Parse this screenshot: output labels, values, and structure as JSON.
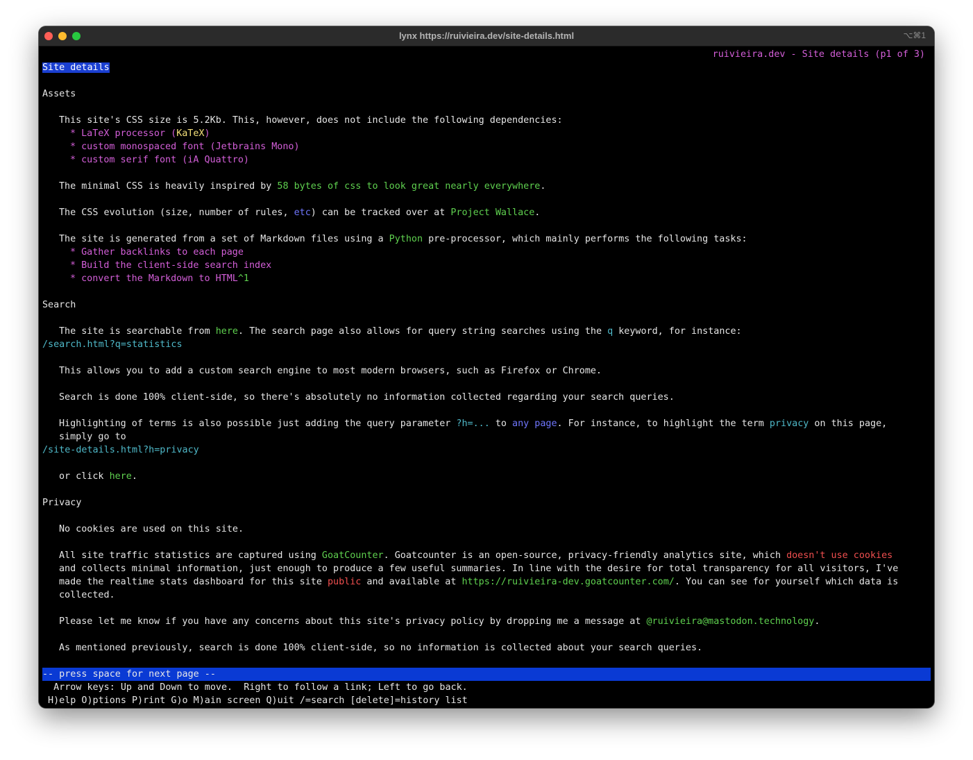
{
  "window": {
    "title": "lynx https://ruivieira.dev/site-details.html",
    "shortcut": "⌥⌘1"
  },
  "page_status": "ruivieira.dev - Site details (p1 of 3)",
  "page_title": "Site details",
  "assets": {
    "heading": "Assets",
    "css_size_text": "This site's CSS size is 5.2Kb. This, however, does not include the following dependencies:",
    "deps": [
      {
        "bullet": "* ",
        "text": "LaTeX processor (",
        "link": "KaTeX",
        "after": ")"
      },
      {
        "bullet": "* ",
        "text": "custom monospaced font (Jetbrains Mono)"
      },
      {
        "bullet": "* ",
        "text": "custom serif font (iA Quattro)"
      }
    ],
    "minimal_pre": "The minimal CSS is heavily inspired by ",
    "minimal_link": "58 bytes of css to look great nearly everywhere",
    "minimal_post": ".",
    "evo_pre": "The CSS evolution (size, number of rules, ",
    "evo_link": "etc",
    "evo_mid": ") can be tracked over at ",
    "evo_link2": "Project Wallace",
    "evo_post": ".",
    "gen_pre": "The site is generated from a set of Markdown files using a ",
    "gen_link": "Python",
    "gen_post": " pre-processor, which mainly performs the following tasks:",
    "tasks": [
      "* Gather backlinks to each page",
      "* Build the client-side search index",
      "* convert the Markdown to HTML"
    ],
    "footnote": "^1"
  },
  "search": {
    "heading": "Search",
    "p1_pre": "The site is searchable from ",
    "p1_link": "here",
    "p1_mid": ". The search page also allows for query string searches using the ",
    "p1_kw": "q",
    "p1_post": " keyword, for instance:",
    "example_url": "/search.html?q=statistics",
    "p2": "This allows you to add a custom search engine to most modern browsers, such as Firefox or Chrome.",
    "p3": "Search is done 100% client-side, so there's absolutely no information collected regarding your search queries.",
    "p4_pre": "Highlighting of terms is also possible just adding the query parameter ",
    "p4_param": "?h=...",
    "p4_mid": " to ",
    "p4_link": "any page",
    "p4_mid2": ". For instance, to highlight the term ",
    "p4_term": "privacy",
    "p4_post": " on this page,",
    "p4_line2": "simply go to",
    "highlight_url": "/site-details.html?h=privacy",
    "p5_pre": "or click ",
    "p5_link": "here",
    "p5_post": "."
  },
  "privacy": {
    "heading": "Privacy",
    "p1": "No cookies are used on this site.",
    "p2_l1_pre": "All site traffic statistics are captured using ",
    "p2_l1_link": "GoatCounter",
    "p2_l1_mid": ". Goatcounter is an open-source, privacy-friendly analytics site, which ",
    "p2_l1_red": "doesn't use cookies",
    "p2_l2": "and collects minimal information, just enough to produce a few useful summaries. In line with the desire for total transparency for all visitors, I've",
    "p2_l3_pre": "made the realtime stats dashboard for this site ",
    "p2_l3_red": "public",
    "p2_l3_mid": " and available at ",
    "p2_l3_link": "https://ruivieira-dev.goatcounter.com/",
    "p2_l3_post": ". You can see for yourself which data is",
    "p2_l4": "collected.",
    "p3_pre": "Please let me know if you have any concerns about this site's privacy policy by dropping me a message at ",
    "p3_link": "@ruivieira@mastodon.technology",
    "p3_post": ".",
    "p4": "As mentioned previously, search is done 100% client-side, so no information is collected about your search queries."
  },
  "statusbar": {
    "next_page": "-- press space for next page --",
    "help1": "  Arrow keys: Up and Down to move.  Right to follow a link; Left to go back.",
    "help2": " H)elp O)ptions P)rint G)o M)ain screen Q)uit /=search [delete]=history list"
  },
  "colors": {
    "link_green": "#5fd14f",
    "bullet_magenta": "#d45fd9",
    "link_blue": "#7077ff",
    "cyan": "#4fb9c9",
    "red": "#f04f4f",
    "status_blue": "#0a3ad4"
  }
}
